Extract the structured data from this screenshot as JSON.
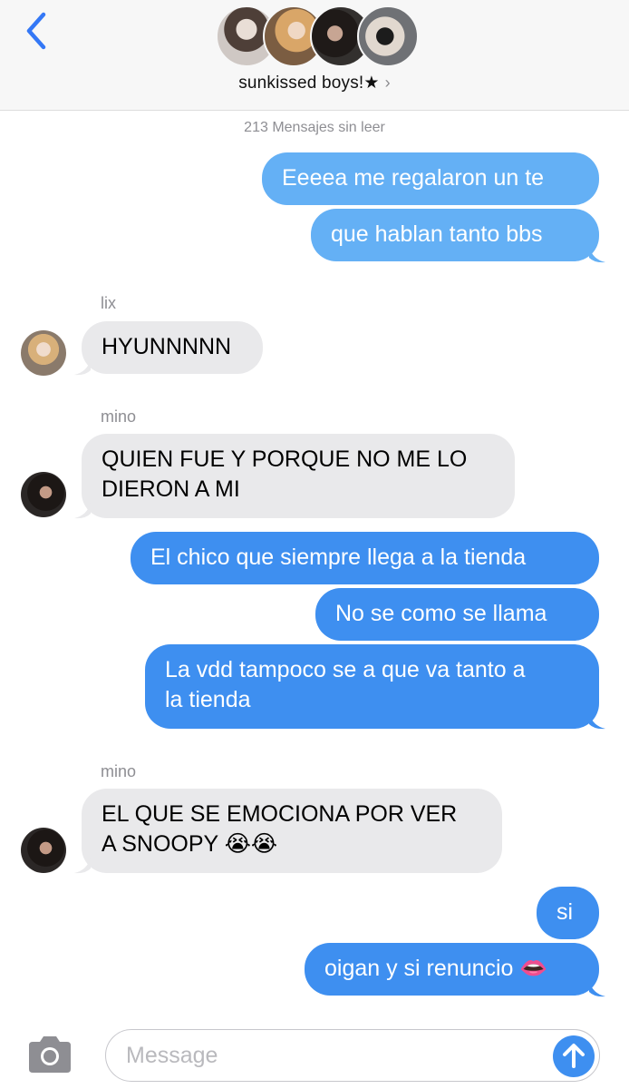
{
  "header": {
    "group_name": "sunkissed boys!★",
    "chevron": "›",
    "back_icon": "chevron-left-icon",
    "avatars": [
      "group-avatar-1",
      "group-avatar-2",
      "group-avatar-3",
      "group-avatar-4"
    ]
  },
  "unread_notice": "213 Mensajes sin leer",
  "messages": [
    {
      "side": "out",
      "text": "Eeeea me regalaron un te"
    },
    {
      "side": "out",
      "text": "que hablan tanto bbs"
    },
    {
      "side": "in",
      "sender": "lix",
      "text": "HYUNNNNN"
    },
    {
      "side": "in",
      "sender": "mino",
      "text": "QUIEN FUE Y PORQUE NO ME LO DIERON A MI"
    },
    {
      "side": "out",
      "text": "El chico que siempre llega a la tienda"
    },
    {
      "side": "out",
      "text": "No se como se llama"
    },
    {
      "side": "out",
      "text": "La vdd tampoco se a que va tanto a la tienda"
    },
    {
      "side": "in",
      "sender": "mino",
      "text": "EL QUE SE EMOCIONA POR VER A SNOOPY 😭😭"
    },
    {
      "side": "out",
      "text": "si"
    },
    {
      "side": "out",
      "text": "oigan y si renuncio 👄"
    }
  ],
  "message_lines": {
    "m3_line1": "QUIEN FUE Y PORQUE NO ME LO",
    "m3_line2": "DIERON A MI",
    "m6_line1": "La vdd tampoco se a que va tanto a",
    "m6_line2": "la tienda",
    "m7_line1": "EL QUE SE EMOCIONA POR VER",
    "m7_line2": "A SNOOPY 😭😭"
  },
  "input_bar": {
    "placeholder": "Message",
    "camera_icon": "camera-icon",
    "send_icon": "send-arrow-icon"
  },
  "colors": {
    "outgoing_bubble": "#64b0f5",
    "outgoing_bubble_deep": "#3e8ff0",
    "incoming_bubble": "#e9e9eb",
    "accent": "#3478f6"
  }
}
